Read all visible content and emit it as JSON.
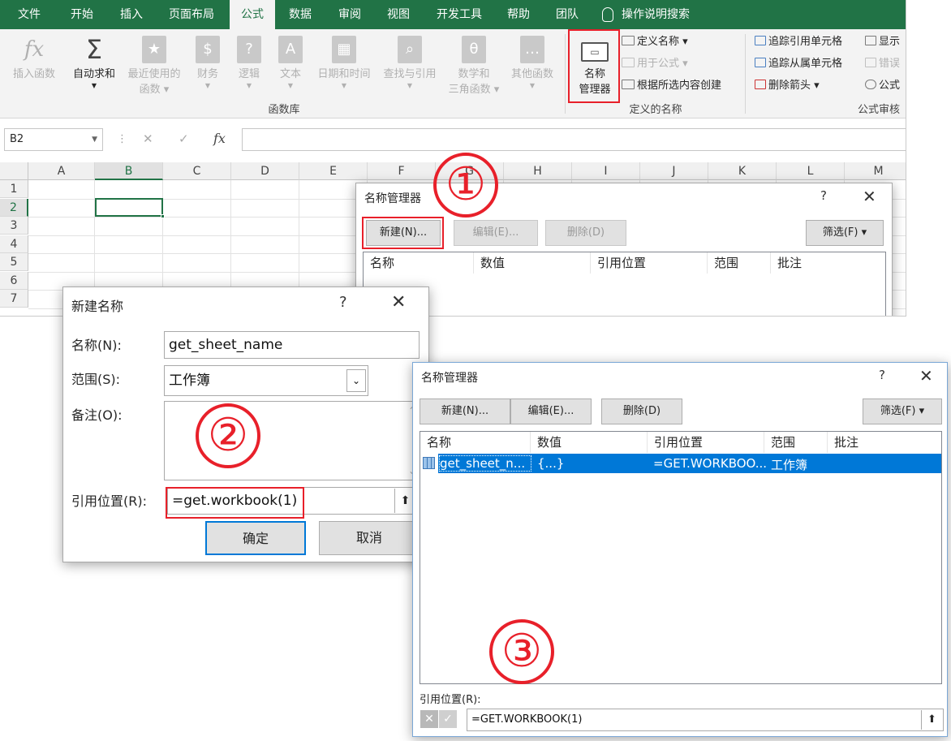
{
  "menu": {
    "tabs": [
      "文件",
      "开始",
      "插入",
      "页面布局",
      "公式",
      "数据",
      "审阅",
      "视图",
      "开发工具",
      "帮助",
      "团队"
    ],
    "active_tab": "公式",
    "tell_me": "操作说明搜索"
  },
  "ribbon": {
    "insert_function": "插入函数",
    "autosum": "自动求和",
    "recent_line1": "最近使用的",
    "recent_line2": "函数",
    "financial": "财务",
    "logical": "逻辑",
    "text": "文本",
    "datetime": "日期和时间",
    "lookup": "查找与引用",
    "math_line1": "数学和",
    "math_line2": "三角函数",
    "more": "其他函数",
    "group_library": "函数库",
    "name_manager_line1": "名称",
    "name_manager_line2": "管理器",
    "define_name": "定义名称",
    "use_in_formula": "用于公式",
    "create_from_selection": "根据所选内容创建",
    "group_defined_names": "定义的名称",
    "trace_precedents": "追踪引用单元格",
    "trace_dependents": "追踪从属单元格",
    "remove_arrows": "删除箭头",
    "show_formulas": "显示",
    "error_checking": "错误",
    "evaluate": "公式",
    "group_auditing": "公式审核",
    "fx_glyph": "fx",
    "sigma_glyph": "Σ"
  },
  "formula_bar": {
    "name_box": "B2",
    "cancel_glyph": "✕",
    "enter_glyph": "✓",
    "fx_glyph": "fx",
    "formula": ""
  },
  "grid": {
    "columns": [
      "A",
      "B",
      "C",
      "D",
      "E",
      "F",
      "G",
      "H",
      "I",
      "J",
      "K",
      "L",
      "M"
    ],
    "rows": [
      "1",
      "2",
      "3",
      "4",
      "5",
      "6",
      "7"
    ],
    "selected_cell": "B2"
  },
  "name_manager_1": {
    "title": "名称管理器",
    "help": "?",
    "close": "✕",
    "new_button": "新建(N)...",
    "edit_button": "编辑(E)...",
    "delete_button": "删除(D)",
    "filter_button": "筛选(F) ▾",
    "columns": [
      "名称",
      "数值",
      "引用位置",
      "范围",
      "批注"
    ]
  },
  "new_name_dialog": {
    "title": "新建名称",
    "help": "?",
    "close": "✕",
    "name_label": "名称(N):",
    "name_value": "get_sheet_name",
    "scope_label": "范围(S):",
    "scope_value": "工作簿",
    "comment_label": "备注(O):",
    "comment_value": "",
    "refers_label": "引用位置(R):",
    "refers_value": "=get.workbook(1)",
    "ok_button": "确定",
    "cancel_button": "取消"
  },
  "name_manager_2": {
    "title": "名称管理器",
    "help": "?",
    "close": "✕",
    "new_button": "新建(N)...",
    "edit_button": "编辑(E)...",
    "delete_button": "删除(D)",
    "filter_button": "筛选(F) ▾",
    "columns": [
      "名称",
      "数值",
      "引用位置",
      "范围",
      "批注"
    ],
    "rows": [
      {
        "name": "get_sheet_n...",
        "value": "{...}",
        "refers_to": "=GET.WORKBOO...",
        "scope": "工作簿",
        "comment": ""
      }
    ],
    "refers_label": "引用位置(R):",
    "refers_value": "=GET.WORKBOOK(1)"
  },
  "annotations": [
    "①",
    "②",
    "③"
  ],
  "colors": {
    "excel_green": "#217346",
    "highlight_red": "#e8202a",
    "selection_blue": "#0078d7"
  }
}
